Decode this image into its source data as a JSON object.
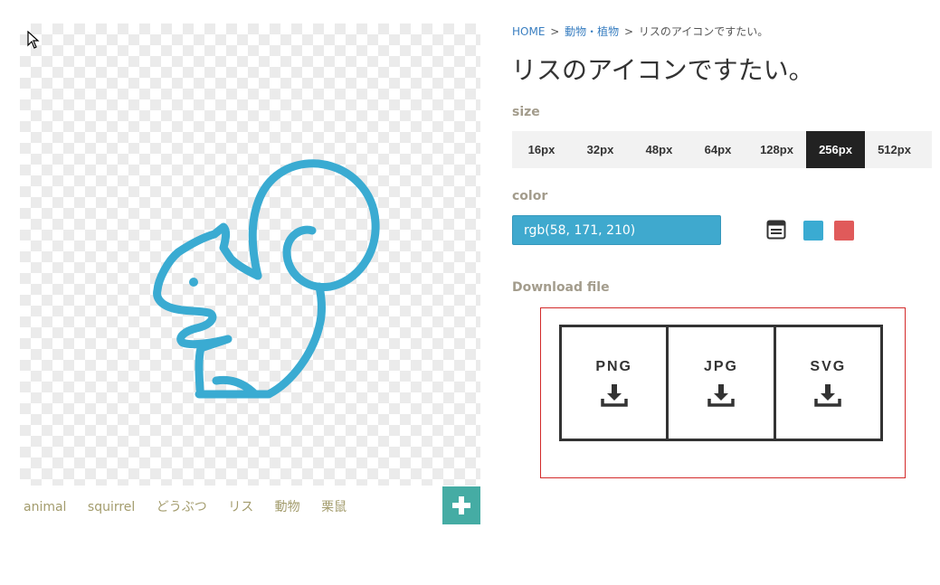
{
  "breadcrumb": {
    "home": "HOME",
    "separator": ">",
    "category": "動物・植物",
    "current": "リスのアイコンですたい。"
  },
  "title": "リスのアイコンですたい。",
  "size": {
    "label": "size",
    "options": [
      "16px",
      "32px",
      "48px",
      "64px",
      "128px",
      "256px",
      "512px"
    ],
    "selected": "256px"
  },
  "color": {
    "label": "color",
    "value": "rgb(58, 171, 210)",
    "swatches": [
      "#3aabd2",
      "#e05a5a"
    ]
  },
  "download": {
    "label": "Download file",
    "formats": [
      "PNG",
      "JPG",
      "SVG"
    ]
  },
  "tags": [
    "animal",
    "squirrel",
    "どうぶつ",
    "リス",
    "動物",
    "栗鼠"
  ],
  "icon": {
    "name": "squirrel-icon",
    "color": "#3aabd2"
  },
  "theme": {
    "accent": "#45aca4",
    "selected_bg": "#222222",
    "highlight": "#d32a2a"
  }
}
